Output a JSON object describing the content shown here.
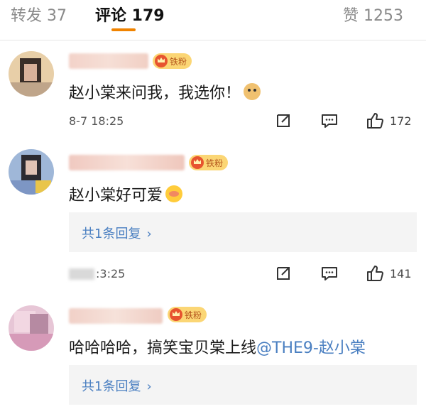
{
  "tabs": [
    {
      "label": "转发 37"
    },
    {
      "label": "评论 179"
    },
    {
      "label": "赞 1253"
    }
  ],
  "badge_label": "铁粉",
  "reply_chevron": "›",
  "comments": [
    {
      "text": "赵小棠来问我，我选你！",
      "emoji": "doge-emoji",
      "time": "8-7 18:25",
      "likes": "172"
    },
    {
      "text": "赵小棠好可爱",
      "emoji": "cute-face-emoji",
      "replies": "共1条回复",
      "time": ":3:25",
      "likes": "141"
    },
    {
      "text_prefix": "哈哈哈哈，搞笑宝贝棠上线",
      "mention": "@THE9-赵小棠",
      "replies": "共1条回复"
    }
  ],
  "colors": {
    "accent_tab": "#f08300",
    "mention": "#4a7fc1",
    "badge_bg": "#fbd675"
  }
}
